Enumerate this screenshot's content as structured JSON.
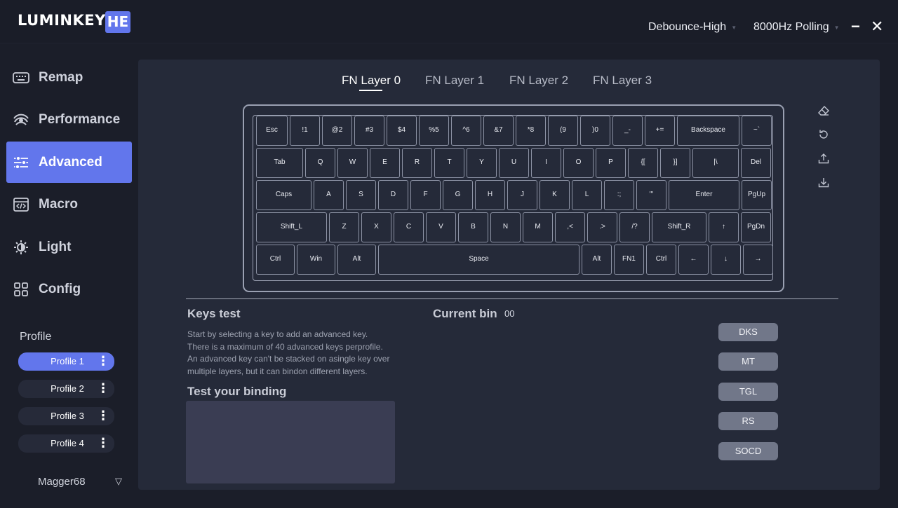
{
  "app": {
    "brand": "LUMINKEY",
    "brand_badge": "HE",
    "debounce": "Debounce-High",
    "polling": "8000Hz Polling",
    "minimize_label": "−",
    "close_label": "✕"
  },
  "sidebar": {
    "items": [
      {
        "label": "Remap",
        "icon": "keyboard-icon"
      },
      {
        "label": "Performance",
        "icon": "signal-icon"
      },
      {
        "label": "Advanced",
        "icon": "sliders-icon"
      },
      {
        "label": "Macro",
        "icon": "code-icon"
      },
      {
        "label": "Light",
        "icon": "sun-icon"
      },
      {
        "label": "Config",
        "icon": "grid-icon"
      }
    ],
    "active": "Advanced",
    "profile_title": "Profile",
    "profiles": [
      "Profile 1",
      "Profile 2",
      "Profile 3",
      "Profile 4"
    ],
    "profile_menu_label": "⋮",
    "active_profile": "Profile 1",
    "device": "Magger68",
    "device_caret": "▽"
  },
  "layers": {
    "tabs": [
      "FN Layer 0",
      "FN Layer 1",
      "FN Layer 2",
      "FN Layer 3"
    ],
    "active": "FN Layer 0"
  },
  "keyboard": {
    "rows": [
      [
        "Esc",
        "!1",
        "@2",
        "#3",
        "$4",
        "%5",
        "^6",
        "&7",
        "*8",
        "(9",
        ")0",
        "_-",
        "+=",
        "Backspace",
        "~`"
      ],
      [
        "Tab",
        "Q",
        "W",
        "E",
        "R",
        "T",
        "Y",
        "U",
        "I",
        "O",
        "P",
        "{[",
        "}]",
        "|\\",
        "Del"
      ],
      [
        "Caps",
        "A",
        "S",
        "D",
        "F",
        "G",
        "H",
        "J",
        "K",
        "L",
        ":;",
        "\"'",
        "Enter",
        "PgUp"
      ],
      [
        "Shift_L",
        "Z",
        "X",
        "C",
        "V",
        "B",
        "N",
        "M",
        ",<",
        ".>",
        "/?",
        "Shift_R",
        "↑",
        "PgDn"
      ],
      [
        "Ctrl",
        "Win",
        "Alt",
        "Space",
        "Alt",
        "FN1",
        "Ctrl",
        "←",
        "↓",
        "→"
      ]
    ]
  },
  "tools": [
    "eraser-icon",
    "reset-icon",
    "export-icon",
    "import-icon"
  ],
  "keys_test": {
    "title": "Keys test",
    "description": [
      "Start by selecting a key to add an advanced key.",
      "There is a maximum of 40 advanced keys perprofile.",
      "An advanced key can't be stacked on asingle key over",
      "multiple layers, but it can bindon different layers."
    ],
    "test_title": "Test your binding"
  },
  "current_bin": {
    "title": "Current bin",
    "value": "00"
  },
  "advanced_buttons": [
    "DKS",
    "MT",
    "TGL",
    "RS",
    "SOCD"
  ],
  "colors": {
    "accent": "#6276ec",
    "background": "#1b1e29",
    "panel": "#252a39",
    "button": "#717789"
  }
}
